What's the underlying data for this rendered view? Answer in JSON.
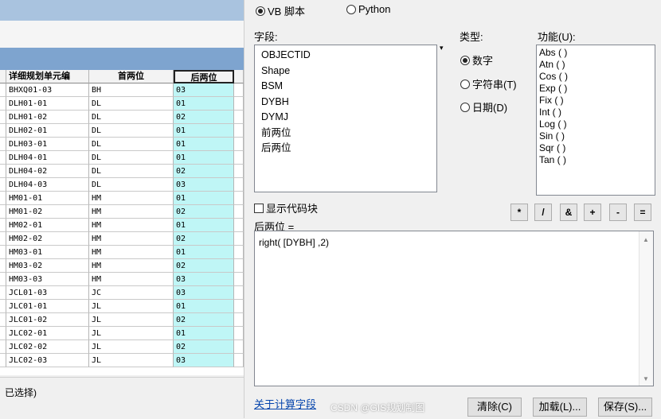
{
  "table": {
    "headers": [
      "详细规划单元编",
      "首两位",
      "后两位"
    ],
    "rows": [
      [
        "BHXQ01-03",
        "BH",
        "03"
      ],
      [
        "DLH01-01",
        "DL",
        "01"
      ],
      [
        "DLH01-02",
        "DL",
        "02"
      ],
      [
        "DLH02-01",
        "DL",
        "01"
      ],
      [
        "DLH03-01",
        "DL",
        "01"
      ],
      [
        "DLH04-01",
        "DL",
        "01"
      ],
      [
        "DLH04-02",
        "DL",
        "02"
      ],
      [
        "DLH04-03",
        "DL",
        "03"
      ],
      [
        "HM01-01",
        "HM",
        "01"
      ],
      [
        "HM01-02",
        "HM",
        "02"
      ],
      [
        "HM02-01",
        "HM",
        "01"
      ],
      [
        "HM02-02",
        "HM",
        "02"
      ],
      [
        "HM03-01",
        "HM",
        "01"
      ],
      [
        "HM03-02",
        "HM",
        "02"
      ],
      [
        "HM03-03",
        "HM",
        "03"
      ],
      [
        "JCL01-03",
        "JC",
        "03"
      ],
      [
        "JLC01-01",
        "JL",
        "01"
      ],
      [
        "JLC01-02",
        "JL",
        "02"
      ],
      [
        "JLC02-01",
        "JL",
        "01"
      ],
      [
        "JLC02-02",
        "JL",
        "02"
      ],
      [
        "JLC02-03",
        "JL",
        "03"
      ]
    ],
    "status": "已选择)"
  },
  "calc": {
    "parser_vb": "VB 脚本",
    "parser_python": "Python",
    "fields_label": "字段:",
    "fields": [
      "OBJECTID",
      "Shape",
      "BSM",
      "DYBH",
      "DYMJ",
      "前两位",
      "后两位"
    ],
    "type_label": "类型:",
    "type_number": "数字",
    "type_string": "字符串(T)",
    "type_date": "日期(D)",
    "func_label": "功能(U):",
    "functions": [
      "Abs ( )",
      "Atn ( )",
      "Cos ( )",
      "Exp ( )",
      "Fix ( )",
      "Int ( )",
      "Log ( )",
      "Sin ( )",
      "Sqr ( )",
      "Tan ( )"
    ],
    "show_codeblock": "显示代码块",
    "target_field": "后两位 =",
    "expression": "right( [DYBH] ,2)",
    "ops": [
      "*",
      "/",
      "&",
      "+",
      "-",
      "="
    ],
    "help_link": "关于计算字段",
    "clear_btn": "清除(C)",
    "load_btn": "加载(L)...",
    "save_btn": "保存(S)...",
    "watermark": "CSDN @GIS规划制图"
  }
}
